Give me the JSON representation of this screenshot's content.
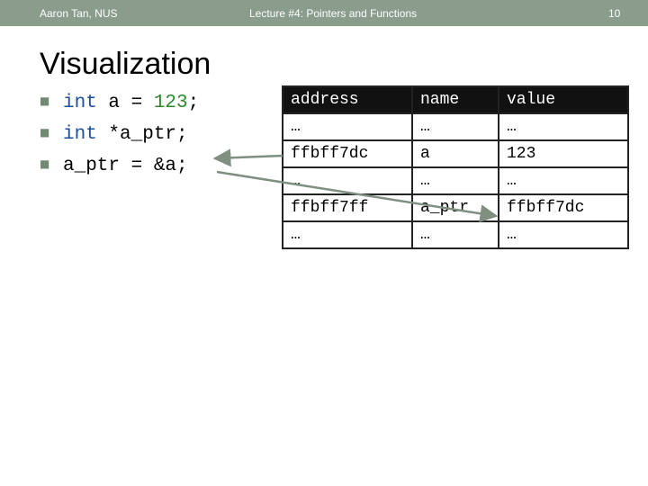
{
  "header": {
    "left": "Aaron Tan, NUS",
    "center": "Lecture #4: Pointers and Functions",
    "page_number": "10"
  },
  "title": "Visualization",
  "code": [
    {
      "parts": [
        {
          "t": "int",
          "c": "kw"
        },
        {
          "t": " a = ",
          "c": ""
        },
        {
          "t": "123",
          "c": "num"
        },
        {
          "t": ";",
          "c": ""
        }
      ]
    },
    {
      "parts": [
        {
          "t": "int",
          "c": "kw"
        },
        {
          "t": " *a_ptr;",
          "c": ""
        }
      ]
    },
    {
      "parts": [
        {
          "t": "a_ptr = &a;",
          "c": ""
        }
      ]
    }
  ],
  "table": {
    "headers": [
      "address",
      "name",
      "value"
    ],
    "rows": [
      [
        "…",
        "…",
        "…"
      ],
      [
        "ffbff7dc",
        "a",
        "123"
      ],
      [
        "…",
        "…",
        "…"
      ],
      [
        "ffbff7ff",
        "a_ptr",
        "ffbff7dc"
      ],
      [
        "…",
        "…",
        "…"
      ]
    ]
  },
  "colors": {
    "header_bar": "#8a9c8c",
    "keyword": "#1f4e9a",
    "number": "#2b8a2b",
    "arrow": "#7f8f80"
  }
}
